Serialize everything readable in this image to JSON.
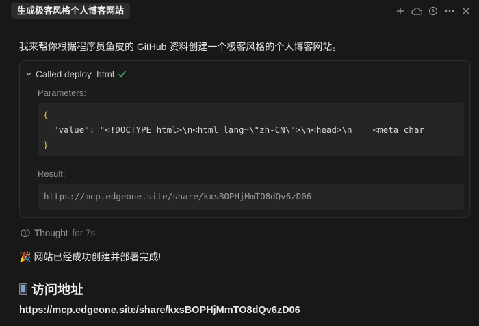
{
  "header": {
    "title": "生成极客风格个人博客网站",
    "actions": [
      "plus-icon",
      "cloud-icon",
      "history-icon",
      "more-icon",
      "close-icon"
    ]
  },
  "message": {
    "intro": "我来帮你根据程序员鱼皮的 GitHub 资料创建一个极客风格的个人博客网站。"
  },
  "tool_call": {
    "called_label": "Called deploy_html",
    "status_icon": "check-icon",
    "parameters_label": "Parameters:",
    "code_open": "{",
    "code_body": "  \"value\": \"<!DOCTYPE html>\\n<html lang=\\\"zh-CN\\\">\\n<head>\\n    <meta char",
    "code_close": "}",
    "result_label": "Result:",
    "result_value": "https://mcp.edgeone.site/share/kxsBOPHjMmTO8dQv6zD06"
  },
  "thought": {
    "label": "Thought",
    "duration": "for 7s"
  },
  "completion": {
    "emoji": "🎉",
    "text": "网站已经成功创建并部署完成!"
  },
  "section": {
    "heading": "访问地址",
    "url": "https://mcp.edgeone.site/share/kxsBOPHjMmTO8dQv6zD06"
  },
  "colors": {
    "background": "#181818",
    "accent_check": "#4bbf73",
    "brace": "#e0c44d"
  }
}
